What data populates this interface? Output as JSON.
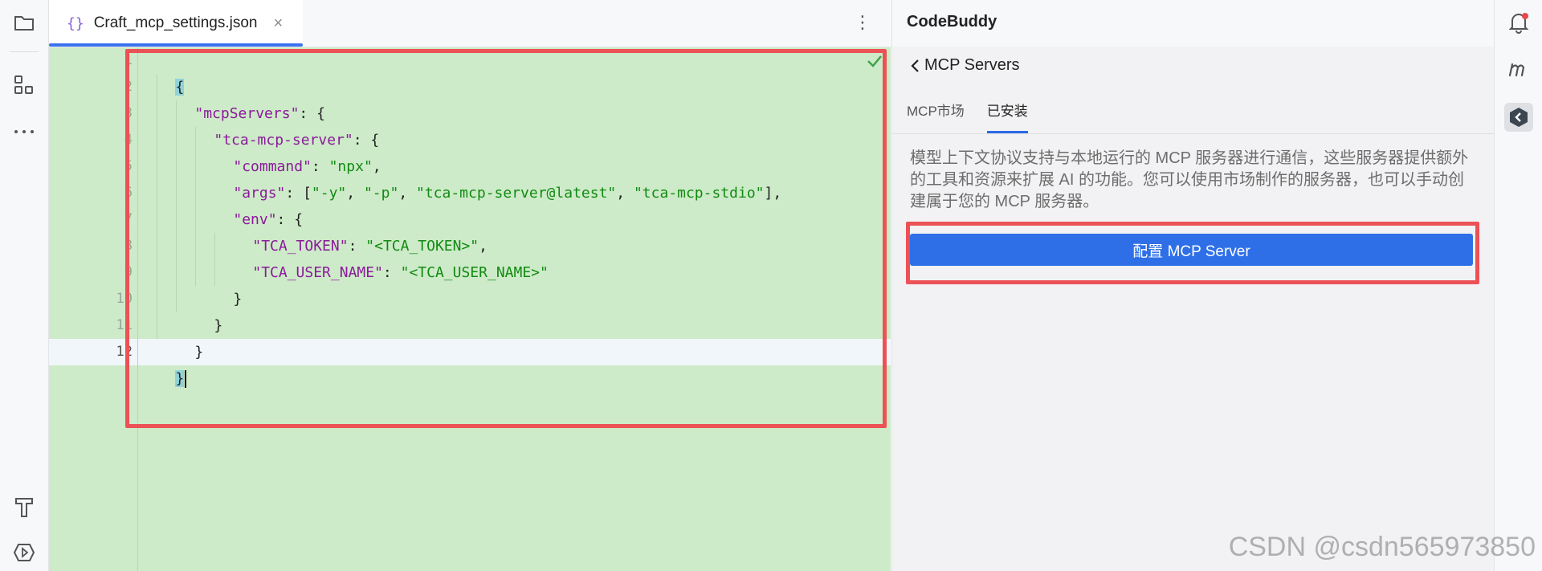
{
  "editor": {
    "tab": {
      "icon": "{}",
      "title": "Craft_mcp_settings.json",
      "close": "×"
    },
    "more": "⋮",
    "line_numbers": [
      "1",
      "2",
      "3",
      "4",
      "5",
      "6",
      "7",
      "8",
      "9",
      "10",
      "11",
      "12"
    ],
    "code": {
      "l1_brace": "{",
      "l2_key": "\"mcpServers\"",
      "l2_rest": ": {",
      "l3_key": "\"tca-mcp-server\"",
      "l3_rest": ": {",
      "l4_key": "\"command\"",
      "l4_colon": ": ",
      "l4_val": "\"npx\"",
      "l4_end": ",",
      "l5_key": "\"args\"",
      "l5_open": ": [",
      "l5_v1": "\"-y\"",
      "l5_c1": ", ",
      "l5_v2": "\"-p\"",
      "l5_c2": ", ",
      "l5_v3": "\"tca-mcp-server@latest\"",
      "l5_c3": ", ",
      "l5_v4": "\"tca-mcp-stdio\"",
      "l5_close": "],",
      "l6_key": "\"env\"",
      "l6_rest": ": {",
      "l7_key": "\"TCA_TOKEN\"",
      "l7_colon": ": ",
      "l7_val": "\"<TCA_TOKEN>\"",
      "l7_end": ",",
      "l8_key": "\"TCA_USER_NAME\"",
      "l8_colon": ": ",
      "l8_val": "\"<TCA_USER_NAME>\"",
      "l9": "}",
      "l10": "}",
      "l11": "}",
      "l12": "}"
    }
  },
  "panel": {
    "title": "CodeBuddy",
    "back_label": "MCP Servers",
    "tabs": [
      {
        "label": "MCP市场",
        "active": false
      },
      {
        "label": "已安装",
        "active": true
      }
    ],
    "description": "模型上下文协议支持与本地运行的 MCP 服务器进行通信，这些服务器提供额外的工具和资源来扩展 AI 的功能。您可以使用市场制作的服务器，也可以手动创建属于您的 MCP 服务器。",
    "configure_button": "配置 MCP Server"
  },
  "watermark": "CSDN @csdn565973850",
  "colors": {
    "accent": "#2e6fe8",
    "diff_green": "#cdebc8",
    "highlight_red": "#ec5156"
  }
}
